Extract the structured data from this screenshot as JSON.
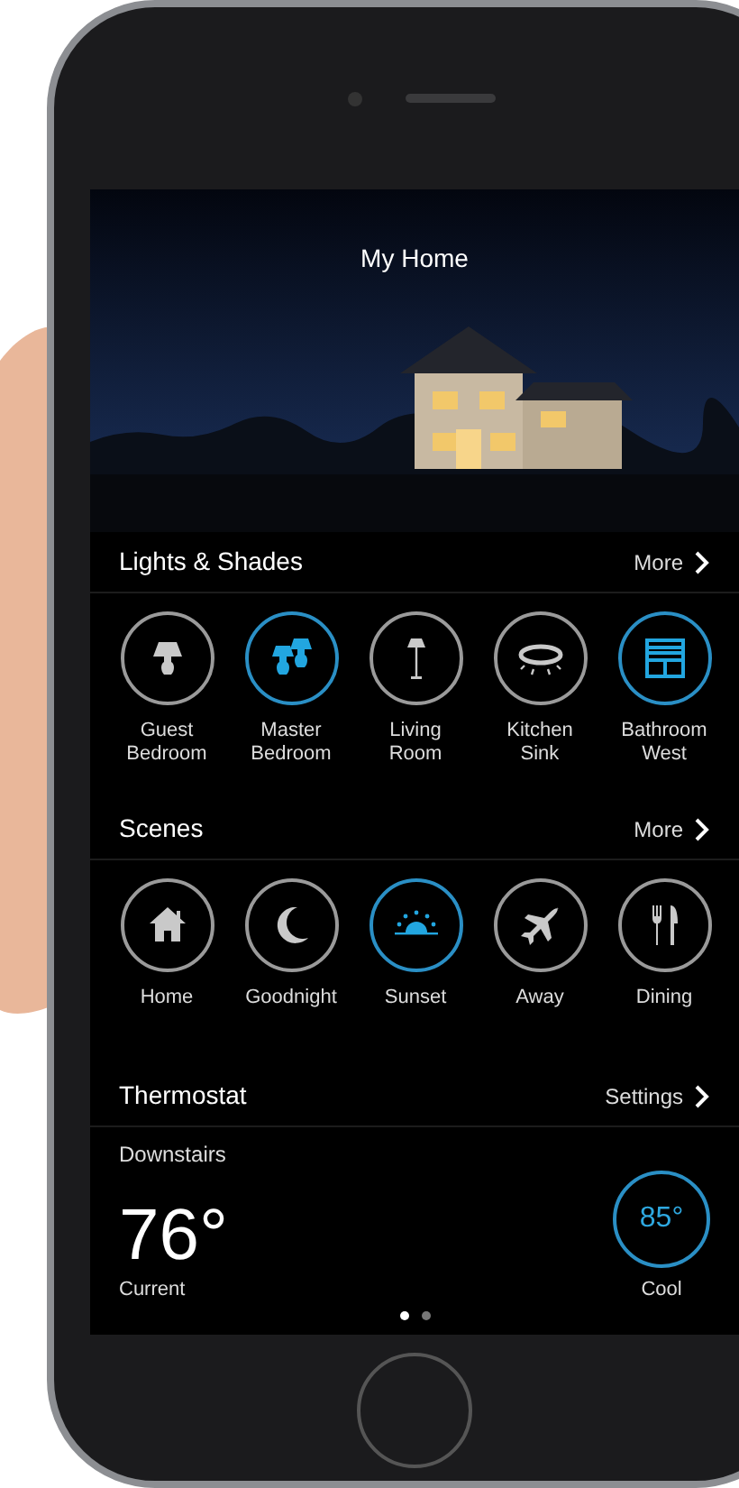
{
  "title": "My Home",
  "sections": [
    {
      "title": "Lights & Shades",
      "action": "More",
      "items": [
        {
          "label": "Guest\nBedroom",
          "selected": false
        },
        {
          "label": "Master\nBedroom",
          "selected": true
        },
        {
          "label": "Living\nRoom",
          "selected": false
        },
        {
          "label": "Kitchen\nSink",
          "selected": false
        },
        {
          "label": "Bathroom\nWest",
          "selected": true
        }
      ]
    },
    {
      "title": "Scenes",
      "action": "More",
      "items": [
        {
          "label": "Home",
          "selected": false
        },
        {
          "label": "Goodnight",
          "selected": false
        },
        {
          "label": "Sunset",
          "selected": true
        },
        {
          "label": "Away",
          "selected": false
        },
        {
          "label": "Dining",
          "selected": false
        }
      ]
    }
  ],
  "thermostat": {
    "title": "Thermostat",
    "action": "Settings",
    "zone": "Downstairs",
    "current": "76°",
    "current_label": "Current",
    "setpoint": "85°",
    "mode": "Cool"
  },
  "pages": [
    {
      "selected": true
    },
    {
      "selected": false
    }
  ]
}
